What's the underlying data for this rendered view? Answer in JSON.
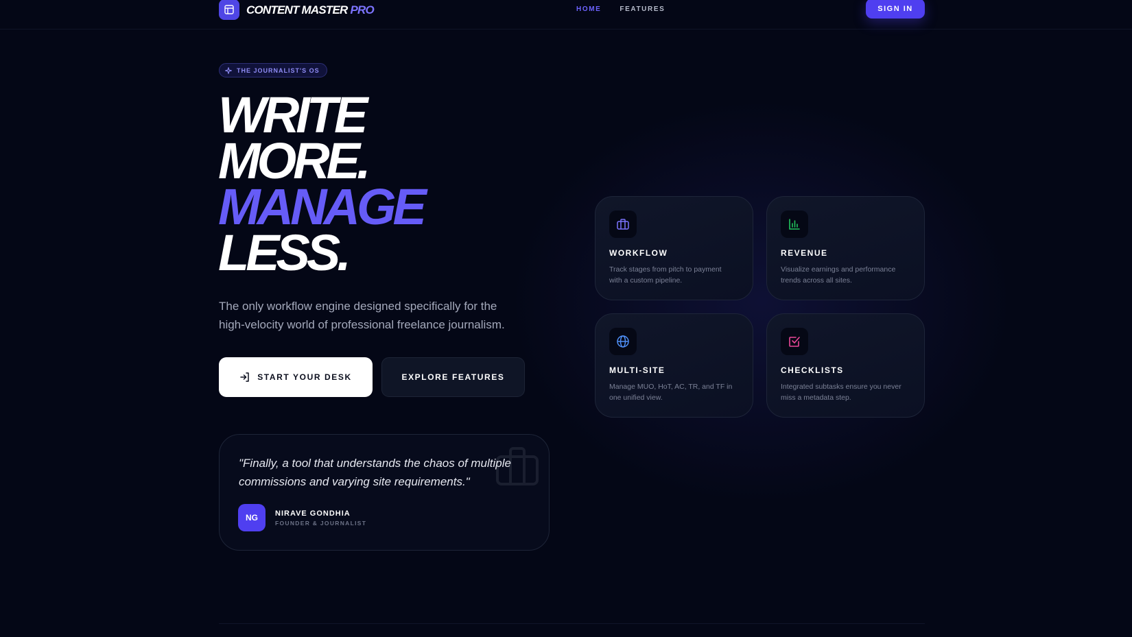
{
  "header": {
    "brand_name": "CONTENT MASTER",
    "brand_suffix": "PRO",
    "nav": [
      {
        "label": "HOME",
        "active": true
      },
      {
        "label": "FEATURES",
        "active": false
      }
    ],
    "signin_label": "SIGN IN"
  },
  "hero": {
    "pill_label": "THE JOURNALIST'S OS",
    "headline": [
      "WRITE",
      "MORE.",
      "MANAGE",
      "LESS."
    ],
    "subtitle": "The only workflow engine designed specifically for the high-velocity world of professional freelance journalism.",
    "primary_cta": "START YOUR DESK",
    "secondary_cta": "EXPLORE FEATURES"
  },
  "testimonial": {
    "quote": "\"Finally, a tool that understands the chaos of multiple commissions and varying site requirements.\"",
    "avatar_initials": "NG",
    "author_name": "NIRAVE GONDHIA",
    "author_role": "FOUNDER & JOURNALIST"
  },
  "features": [
    {
      "icon": "briefcase-icon",
      "color": "#7c74ff",
      "title": "WORKFLOW",
      "desc": "Track stages from pitch to payment with a custom pipeline."
    },
    {
      "icon": "bar-chart-icon",
      "color": "#22c55e",
      "title": "REVENUE",
      "desc": "Visualize earnings and performance trends across all sites."
    },
    {
      "icon": "globe-icon",
      "color": "#4f8ff7",
      "title": "MULTI-SITE",
      "desc": "Manage MUO, HoT, AC, TR, and TF in one unified view."
    },
    {
      "icon": "checkbox-icon",
      "color": "#ec4899",
      "title": "CHECKLISTS",
      "desc": "Integrated subtasks ensure you never miss a metadata step."
    }
  ],
  "colors": {
    "background": "#040716",
    "accent": "#665cf7",
    "button_accent": "#4f3ff0"
  }
}
